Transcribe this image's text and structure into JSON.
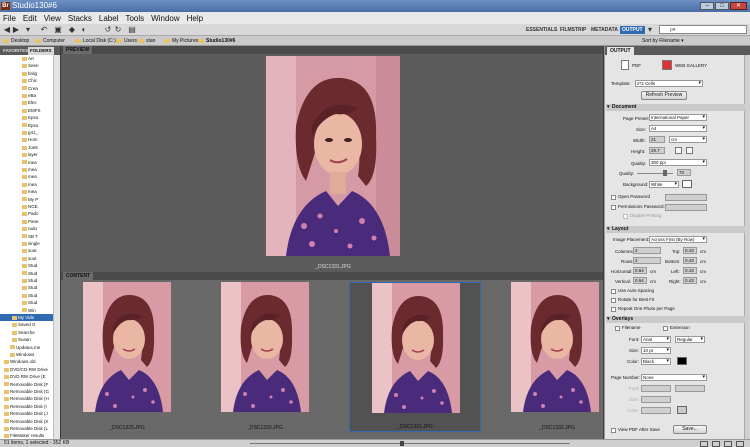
{
  "window": {
    "title": "Studio130#6",
    "app_icon": "Br"
  },
  "menu": [
    "File",
    "Edit",
    "View",
    "Stacks",
    "Label",
    "Tools",
    "Window",
    "Help"
  ],
  "workspaces": {
    "essentials": "ESSENTIALS",
    "filmstrip": "FILMSTRIP",
    "metadata": "METADATA",
    "output": "OUTPUT"
  },
  "search": {
    "placeholder": "ρ▾"
  },
  "path": [
    "Desktop",
    "Computer",
    "Local Disk (C:)",
    "Users",
    "stan",
    "My Pictures",
    "Studio130#6"
  ],
  "sort": {
    "label": "Sort by Filename ▾"
  },
  "left_panel": {
    "tabs": [
      "FAVORITES",
      "FOLDERS"
    ],
    "tree": [
      "Art",
      "Seen",
      "brdg",
      "Chic",
      "Crea",
      "eBa",
      "Elec",
      "EMFS",
      "Epso",
      "Epso",
      "g41_",
      "Hom",
      "Joe5",
      "layer",
      "mea",
      "mea",
      "mea",
      "mea",
      "mea",
      "My P",
      "NGE",
      "Pado",
      "Pane",
      "rudo",
      "SB T",
      "single",
      "sout",
      "sout",
      "Stud",
      "Stud",
      "Stud",
      "Stud",
      "Stud",
      "Stud",
      "Win",
      "My Vide",
      "Saved G",
      "Searche",
      "Susan",
      "Updatus.me",
      "Windows",
      "Windows.old",
      "DVD/CD-RW Drive",
      "DVD RW Drive (E",
      "Removable Disk (F",
      "Removable Disk (G",
      "Removable Disk (H",
      "Removable Disk (I",
      "Removable Disk (J",
      "Removable Disk (K",
      "Removable Disk (L",
      "FileMaker results"
    ],
    "selected_index": 35
  },
  "preview": {
    "tab": "PREVIEW",
    "caption": "_DSC1331.JPG"
  },
  "content": {
    "tab": "CONTENT",
    "thumbs": [
      {
        "name": "_DSC1329.JPG",
        "selected": false
      },
      {
        "name": "_DSC1330.JPG",
        "selected": false
      },
      {
        "name": "_DSC1331.JPG",
        "selected": true
      },
      {
        "name": "_DSC1332.JPG",
        "selected": false
      }
    ]
  },
  "output": {
    "tab": "OUTPUT",
    "pdf_label": "PDF",
    "web_label": "WEB GALLERY",
    "template_label": "Template:",
    "template_value": "2*2 Cells",
    "refresh_label": "Refresh Preview",
    "document": {
      "title": "Document",
      "page_preset_label": "Page Preset:",
      "page_preset": "International Paper",
      "size_label": "Size:",
      "size": "A4",
      "width_label": "Width:",
      "width": "21",
      "width_unit": "cm",
      "height_label": "Height:",
      "height": "29.7",
      "quality_label": "Quality:",
      "quality": "300 ppi",
      "quality2_label": "Quality:",
      "quality2": "70",
      "background_label": "Background:",
      "background": "White",
      "open_password": "Open Password",
      "permissions_password": "Permissions Password:",
      "disable_printing": "Disable Printing"
    },
    "layout": {
      "title": "Layout",
      "image_placement_label": "Image Placement:",
      "image_placement": "Across First (By Row)",
      "columns_label": "Columns:",
      "columns": "2",
      "rows_label": "Rows:",
      "rows": "2",
      "horizontal_label": "Horizontal:",
      "horizontal": "0.64",
      "vertical_label": "Vertical:",
      "vertical": "0.64",
      "top_label": "Top:",
      "top": "0.43",
      "bottom_label": "Bottom:",
      "bottom": "0.43",
      "left_label": "Left:",
      "left": "0.43",
      "right_label": "Right:",
      "right": "0.43",
      "unit": "cm",
      "auto_spacing": "Use Auto-Spacing",
      "rotate": "Rotate for Best Fit",
      "repeat": "Repeat One Photo per Page"
    },
    "overlays": {
      "title": "Overlays",
      "filename": "Filename",
      "extension": "Extension",
      "font_label": "Font:",
      "font": "Arial",
      "style": "Regular",
      "size_label": "Size:",
      "size": "10 pt",
      "color_label": "Color:",
      "color": "Black",
      "page_number_label": "Page Number:",
      "page_number": "None",
      "font2_label": "Font:",
      "size2_label": "Size:",
      "color2_label": "Color:"
    },
    "view_pdf": "View PDF After Save",
    "save_label": "Save..."
  },
  "status": {
    "text": "51 items, 1 selected - 352 KB"
  },
  "colors": {
    "accent": "#2f6bb0",
    "shirt": "#4a2a7a",
    "hair": "#5a2a2a",
    "skin": "#e8b9a6",
    "bg_pink": "#d89aa4"
  }
}
